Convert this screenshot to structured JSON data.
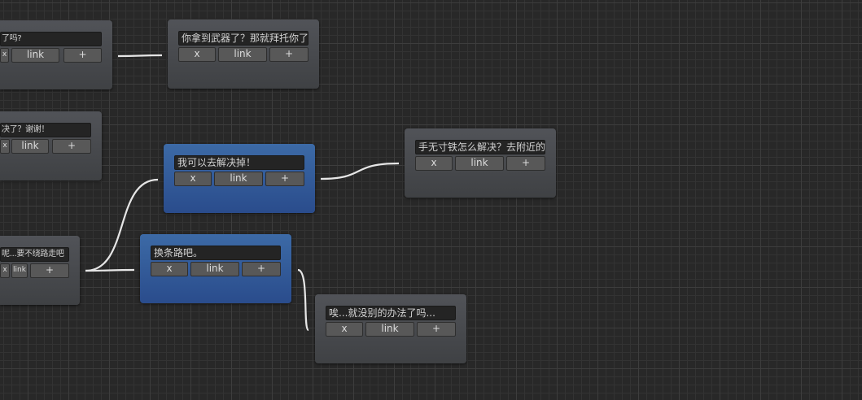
{
  "colors": {
    "canvas": "#282828",
    "node": "#4a4c50",
    "node_selected": "#2f5b9a",
    "wire": "#e6e6e6"
  },
  "nodes": [
    {
      "id": "n1",
      "text": "了吗?",
      "selected": false,
      "buttons": {
        "delete": "x",
        "link": "link",
        "add": "+"
      }
    },
    {
      "id": "n2",
      "text": "你拿到武器了？那就拜托你了",
      "selected": false,
      "buttons": {
        "delete": "x",
        "link": "link",
        "add": "+"
      }
    },
    {
      "id": "n3",
      "text": "决了？谢谢！",
      "selected": false,
      "buttons": {
        "delete": "x",
        "link": "link",
        "add": "+"
      }
    },
    {
      "id": "n4",
      "text": "我可以去解决掉！",
      "selected": true,
      "buttons": {
        "delete": "x",
        "link": "link",
        "add": "+"
      }
    },
    {
      "id": "n5",
      "text": "手无寸铁怎么解决？去附近的",
      "selected": false,
      "buttons": {
        "delete": "x",
        "link": "link",
        "add": "+"
      }
    },
    {
      "id": "n6",
      "text": "呢...要不绕路走吧",
      "selected": false,
      "buttons": {
        "delete": "x",
        "link": "link",
        "add": "+"
      }
    },
    {
      "id": "n7",
      "text": "换条路吧。",
      "selected": true,
      "buttons": {
        "delete": "x",
        "link": "link",
        "add": "+"
      }
    },
    {
      "id": "n8",
      "text": "唉...就没别的办法了吗...",
      "selected": false,
      "buttons": {
        "delete": "x",
        "link": "link",
        "add": "+"
      }
    }
  ],
  "connections": [
    [
      "n1",
      "n2"
    ],
    [
      "n4",
      "n5"
    ],
    [
      "n6",
      "n4"
    ],
    [
      "n6",
      "n7"
    ],
    [
      "n7",
      "n8"
    ]
  ]
}
